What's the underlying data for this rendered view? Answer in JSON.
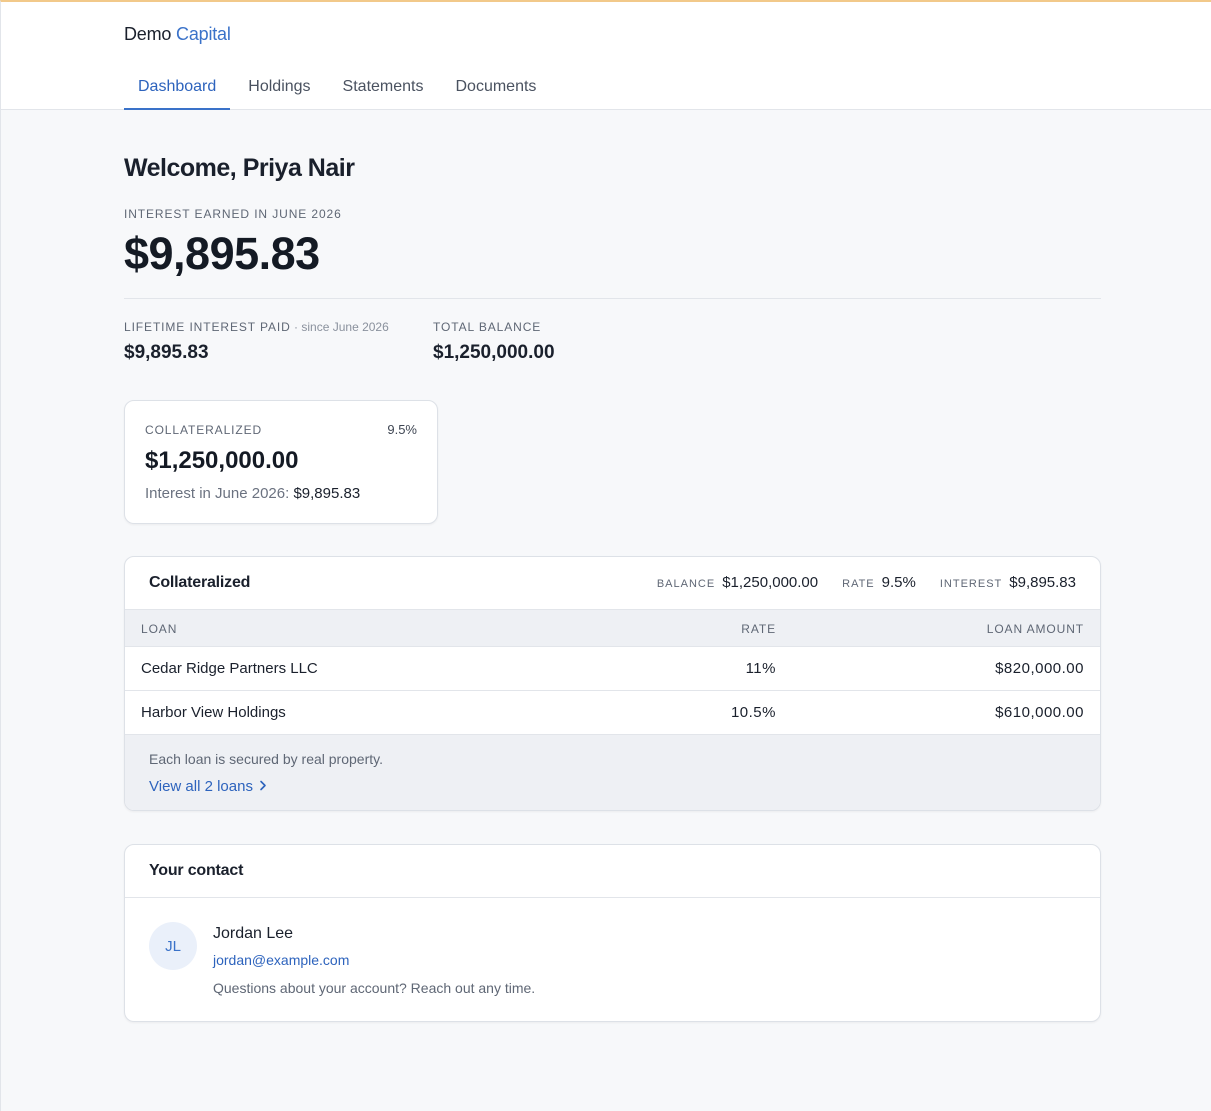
{
  "brand": {
    "first": "Demo",
    "second": "Capital"
  },
  "nav": {
    "tabs": [
      {
        "label": "Dashboard",
        "active": true
      },
      {
        "label": "Holdings",
        "active": false
      },
      {
        "label": "Statements",
        "active": false
      },
      {
        "label": "Documents",
        "active": false
      }
    ]
  },
  "summary": {
    "welcome": "Welcome, Priya Nair",
    "interest_label": "INTEREST EARNED IN JUNE 2026",
    "interest_value": "$9,895.83",
    "lifetime_label": "LIFETIME INTEREST PAID",
    "lifetime_since": " · since June 2026",
    "lifetime_value": "$9,895.83",
    "total_label": "TOTAL BALANCE",
    "total_value": "$1,250,000.00"
  },
  "product_card": {
    "label": "COLLATERALIZED",
    "rate": "9.5%",
    "amount": "$1,250,000.00",
    "interest_label": "Interest in June 2026: ",
    "interest_value": "$9,895.83"
  },
  "loans_panel": {
    "title": "Collateralized",
    "stats": {
      "balance_label": "BALANCE",
      "balance_value": "$1,250,000.00",
      "rate_label": "RATE",
      "rate_value": "9.5%",
      "interest_label": "INTEREST",
      "interest_value": "$9,895.83"
    },
    "columns": {
      "loan": "LOAN",
      "rate": "RATE",
      "amount": "LOAN AMOUNT"
    },
    "rows": [
      {
        "loan": "Cedar Ridge Partners LLC",
        "rate": "11%",
        "amount": "$820,000.00"
      },
      {
        "loan": "Harbor View Holdings",
        "rate": "10.5%",
        "amount": "$610,000.00"
      }
    ],
    "footer_note": "Each loan is secured by real property.",
    "view_all": "View all 2 loans"
  },
  "contact": {
    "title": "Your contact",
    "initials": "JL",
    "name": "Jordan Lee",
    "email": "jordan@example.com",
    "note": "Questions about your account? Reach out any time."
  },
  "colors": {
    "accent": "#3a72c9",
    "link": "#2d63bd",
    "top_border": "#f2c98a"
  }
}
